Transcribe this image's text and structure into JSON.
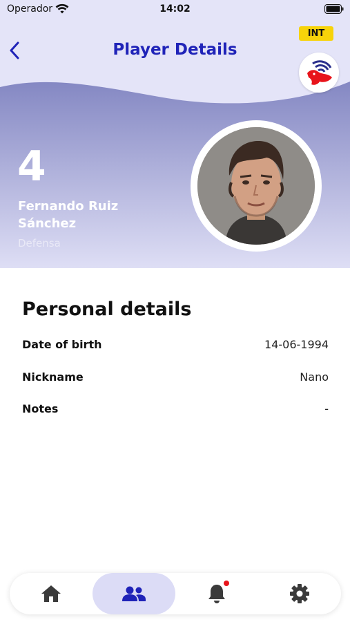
{
  "status_bar": {
    "carrier": "Operador",
    "time": "14:02",
    "icons": [
      "wifi-icon",
      "battery-icon"
    ]
  },
  "nav": {
    "back_icon": "chevron-left-icon",
    "title": "Player Details",
    "badge": "INT",
    "team_logo_icon": "team-logo-bird-icon"
  },
  "player": {
    "number": "4",
    "name": "Fernando Ruiz Sánchez",
    "position": "Defensa"
  },
  "personal_details": {
    "title": "Personal details",
    "rows": [
      {
        "label": "Date of birth",
        "value": "14-06-1994"
      },
      {
        "label": "Nickname",
        "value": "Nano"
      },
      {
        "label": "Notes",
        "value": "-"
      }
    ]
  },
  "tab_bar": {
    "tabs": [
      {
        "icon": "home-icon",
        "active": false
      },
      {
        "icon": "people-icon",
        "active": true
      },
      {
        "icon": "bell-icon",
        "active": false,
        "has_notification": true
      },
      {
        "icon": "gear-icon",
        "active": false
      }
    ]
  },
  "colors": {
    "accent": "#1f23b8",
    "header_top": "#e4e4f8",
    "header_gradient_start": "#5d62ad",
    "header_gradient_end": "#dedef5",
    "badge": "#f7d30a",
    "active_tab": "#dcdcf6",
    "notification": "#e8141b"
  }
}
